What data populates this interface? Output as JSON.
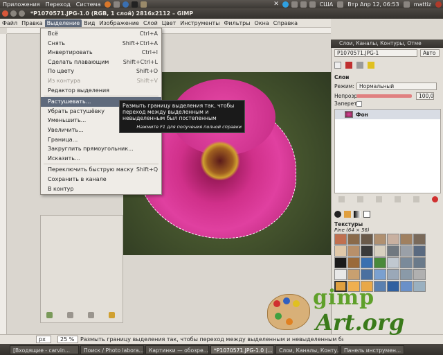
{
  "top_panel": {
    "menus": [
      "Приложения",
      "Переход",
      "Система"
    ],
    "keyboard": "США",
    "datetime": "Втр Апр 12, 06:53",
    "user": "mattiz"
  },
  "window": {
    "title": "*P1070571.JPG-1.0 (RGB, 1 слой) 2816x2112 – GIMP"
  },
  "menubar": {
    "items": [
      "Файл",
      "Правка",
      "Выделение",
      "Вид",
      "Изображение",
      "Слой",
      "Цвет",
      "Инструменты",
      "Фильтры",
      "Окна",
      "Справка"
    ],
    "active_index": 2
  },
  "select_menu": {
    "items": [
      {
        "label": "Всё",
        "shortcut": "Ctrl+A"
      },
      {
        "label": "Снять",
        "shortcut": "Shift+Ctrl+A"
      },
      {
        "label": "Инвертировать",
        "shortcut": "Ctrl+I"
      },
      {
        "label": "Сделать плавающим",
        "shortcut": "Shift+Ctrl+L"
      },
      {
        "label": "По цвету",
        "shortcut": "Shift+O"
      },
      {
        "label": "Из контура",
        "shortcut": "Shift+V"
      },
      {
        "label": "Редактор выделения",
        "shortcut": ""
      },
      {
        "label": "Растушевать...",
        "shortcut": ""
      },
      {
        "label": "Убрать растушёвку",
        "shortcut": ""
      },
      {
        "label": "Уменьшить...",
        "shortcut": ""
      },
      {
        "label": "Увеличить...",
        "shortcut": ""
      },
      {
        "label": "Граница...",
        "shortcut": ""
      },
      {
        "label": "Закруглить прямоугольник...",
        "shortcut": ""
      },
      {
        "label": "Исказить...",
        "shortcut": ""
      },
      {
        "label": "Переключить быструю маску",
        "shortcut": "Shift+Q"
      },
      {
        "label": "Сохранить в канале",
        "shortcut": ""
      },
      {
        "label": "В контур",
        "shortcut": ""
      }
    ]
  },
  "tooltip": {
    "text": "Размыть границу выделения так, чтобы переход между выделенным и невыделенным был постепенным",
    "hint": "Нажмите F1 для получения полной справки"
  },
  "statusbar": {
    "unit": "px",
    "zoom": "25 %",
    "message": "Размыть границу выделения так, чтобы переход между выделенным и невыделенным был постепенным"
  },
  "dock": {
    "title": "Слои, Каналы, Контуры, Отме",
    "image_combo": "P1070571.JPG-1",
    "auto_button": "Авто",
    "layers_label": "Слои",
    "mode_label": "Режим:",
    "mode_value": "Нормальный",
    "opacity_label": "Непрозр.:",
    "opacity_value": "100,0",
    "lock_label": "Запереть:",
    "layer_name": "Фон",
    "textures_label": "Текстуры",
    "texture_selected": "Pine (64 × 56)"
  },
  "logo": {
    "word1": "gimp",
    "word2": "Art.org"
  },
  "taskbar": {
    "tasks": [
      "[Входящие - carvin...",
      "Поиск / Photo labora...",
      "Картинки — обозре...",
      "*P1070571.JPG-1.0 (...",
      "Слои, Каналы, Конту...",
      "Панель инструмен..."
    ],
    "active_index": 3
  },
  "colors": {
    "highlight": "#5f6a7c",
    "tooltip_bg": "#1a1a1a",
    "logo_green": "#5fa02a"
  }
}
